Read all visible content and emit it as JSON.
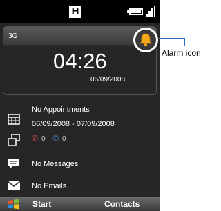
{
  "status_bar": {
    "h_indicator": "H",
    "battery_icon": "battery-icon",
    "signal_icon": "signal-icon"
  },
  "clock": {
    "network": "3G",
    "time": "04:26",
    "date": "06/09/2008",
    "alarm_icon": "alarm-bell-icon"
  },
  "appointments": {
    "label": "No Appointments",
    "range": "06/09/2008 - 07/09/2008"
  },
  "calls": {
    "missed_count": "0",
    "voicemail_count": "0"
  },
  "messages": {
    "label": "No Messages"
  },
  "emails": {
    "label": "No Emails"
  },
  "softkeys": {
    "left": "Start",
    "right": "Contacts"
  },
  "annotation": {
    "label": "Alarm icon"
  },
  "colors": {
    "alarm_orange": "#f7a81b",
    "callout_line": "#2b6fc1",
    "missed_call_red": "#d84848",
    "voicemail_blue": "#4d8ad8"
  }
}
